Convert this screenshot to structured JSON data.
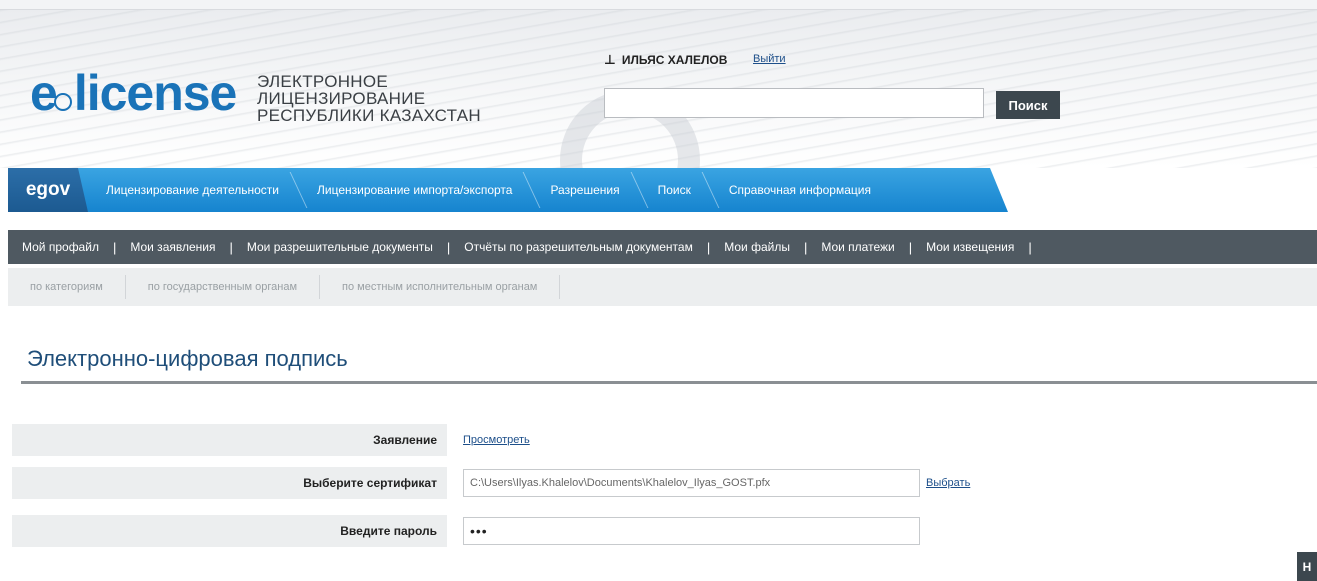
{
  "header": {
    "logo_text": "elicense",
    "tagline_line1": "ЭЛЕКТРОННОЕ ЛИЦЕНЗИРОВАНИЕ",
    "tagline_line2": "РЕСПУБЛИКИ КАЗАХСТАН",
    "user_name": "ИЛЬЯС ХАЛЕЛОВ",
    "logout_label": "Выйти",
    "search_value": "",
    "search_button": "Поиск"
  },
  "egov_nav": {
    "logo": "egov",
    "items": [
      {
        "label": "Лицензирование деятельности"
      },
      {
        "label": "Лицензирование импорта/экспорта"
      },
      {
        "label": "Разрешения"
      },
      {
        "label": "Поиск"
      },
      {
        "label": "Справочная информация"
      }
    ]
  },
  "main_nav": {
    "items": [
      {
        "label": "Мой профайл"
      },
      {
        "label": "Мои заявления"
      },
      {
        "label": "Мои разрешительные документы"
      },
      {
        "label": "Отчёты по разрешительным документам"
      },
      {
        "label": "Мои файлы"
      },
      {
        "label": "Мои платежи"
      },
      {
        "label": "Мои извещения"
      }
    ]
  },
  "sub_nav": {
    "items": [
      {
        "label": "по категориям"
      },
      {
        "label": "по государственным органам"
      },
      {
        "label": "по местным исполнительным органам"
      }
    ]
  },
  "page": {
    "title": "Электронно-цифровая подпись"
  },
  "form": {
    "application_label": "Заявление",
    "application_link": "Просмотреть",
    "certificate_label": "Выберите сертификат",
    "certificate_value": "C:\\Users\\Ilyas.Khalelov\\Documents\\Khalelov_Ilyas_GOST.pfx",
    "certificate_choose": "Выбрать",
    "password_label": "Введите пароль",
    "password_value": "•••"
  },
  "corner_button": "Н"
}
